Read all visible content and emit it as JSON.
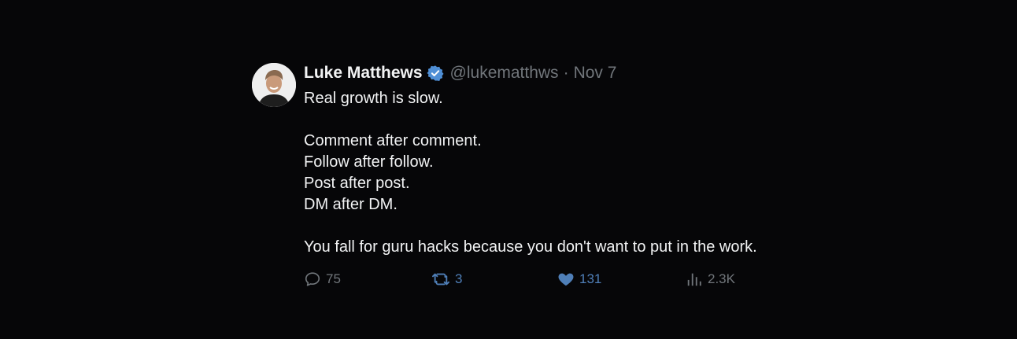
{
  "author": {
    "display_name": "Luke Matthews",
    "handle": "@lukematthws",
    "separator": "·",
    "date": "Nov 7",
    "verified": true,
    "verified_color": "#4f8fd6"
  },
  "tweet": {
    "lines": [
      "Real growth is slow.",
      "",
      "Comment after comment.",
      "Follow after follow.",
      "Post after post.",
      "DM after DM.",
      "",
      "You fall for guru hacks because you don't want to put in the work."
    ]
  },
  "actions": {
    "reply_count": "75",
    "retweet_count": "3",
    "like_count": "131",
    "views_count": "2.3K",
    "icons": {
      "reply": "reply-icon",
      "retweet": "retweet-icon",
      "like": "heart-icon",
      "views": "views-icon"
    },
    "accent_color": "#4f7fb8"
  }
}
